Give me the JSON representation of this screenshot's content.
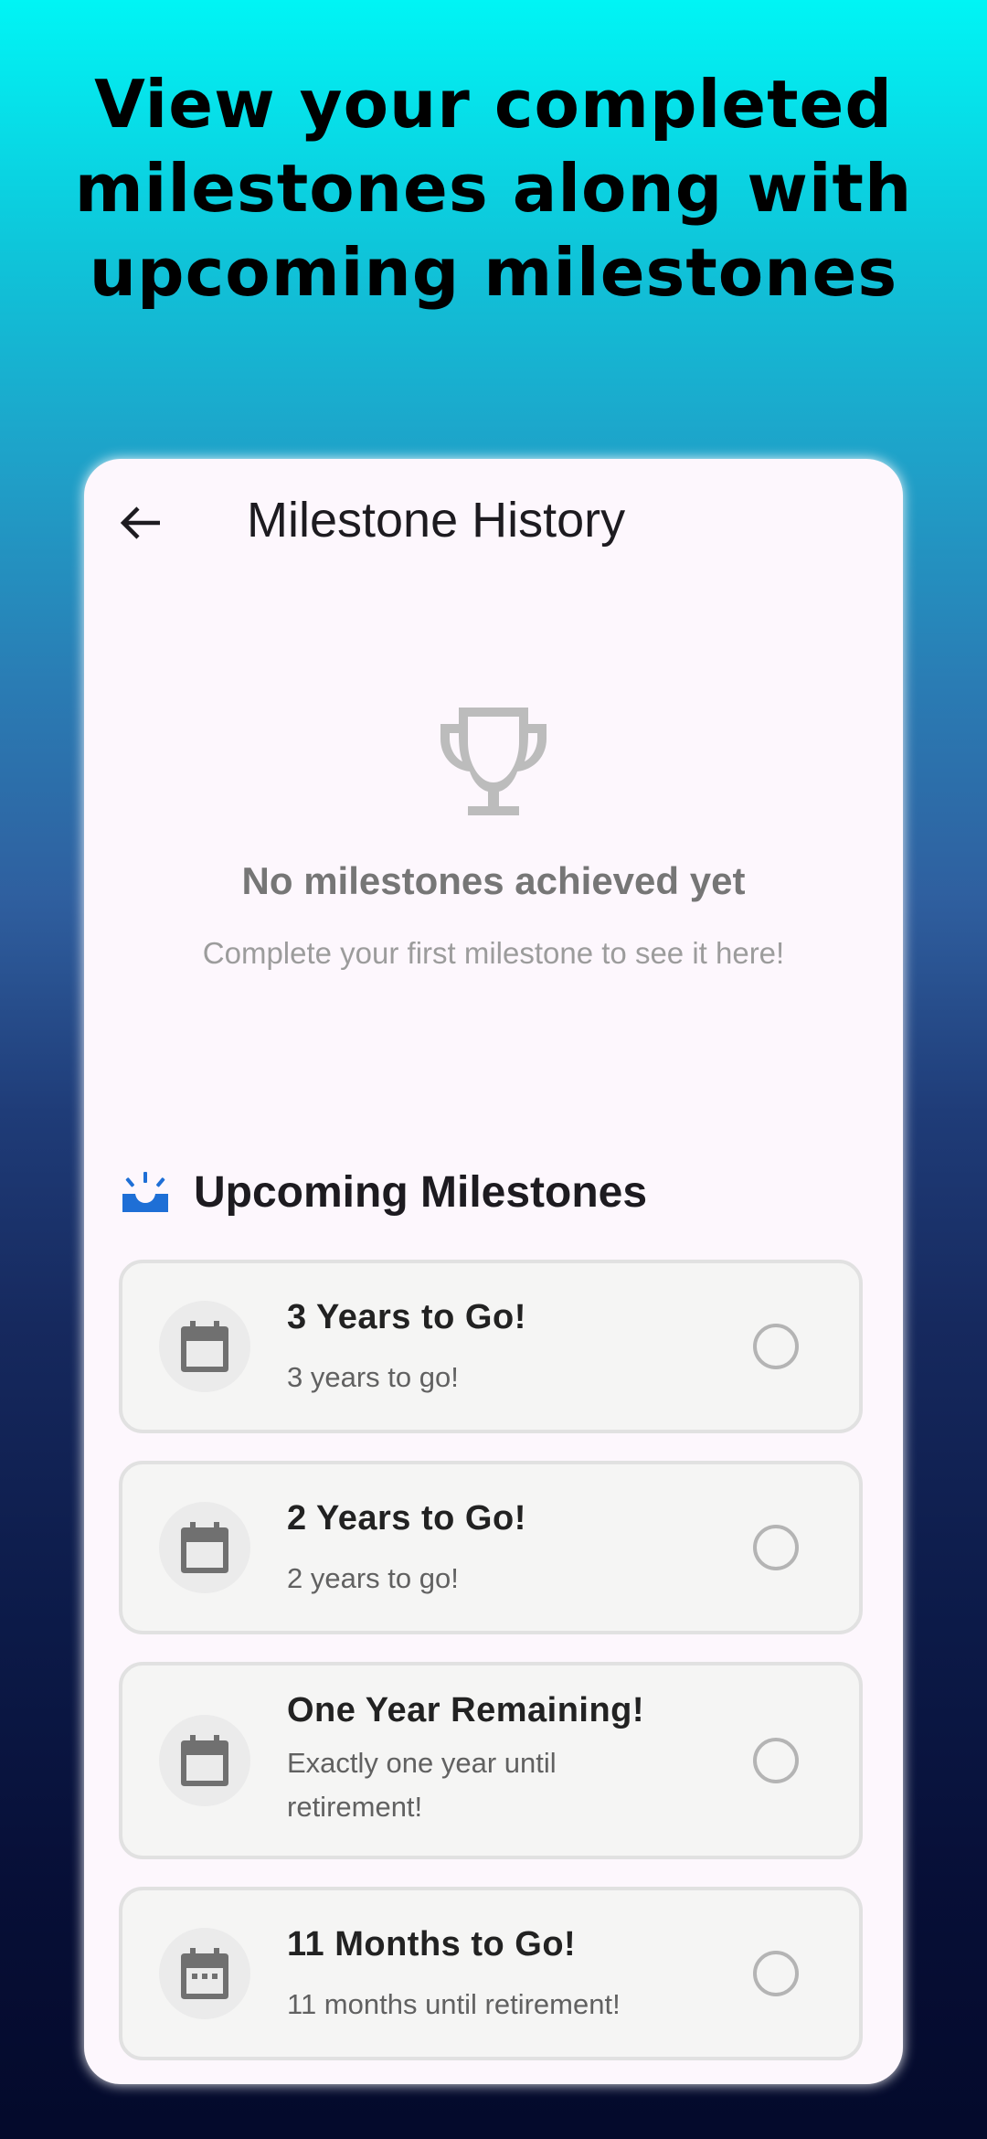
{
  "promo": {
    "headline": "View your completed milestones along with upcoming milestones"
  },
  "app_bar": {
    "back_icon": "arrow-back-icon",
    "title": "Milestone History"
  },
  "empty_state": {
    "icon": "trophy-icon",
    "title": "No milestones achieved yet",
    "subtitle": "Complete your first milestone to see it here!"
  },
  "upcoming": {
    "icon": "upcoming-icon",
    "title": "Upcoming Milestones",
    "items": [
      {
        "title": "3 Years to Go!",
        "subtitle": "3 years to go!",
        "icon": "calendar-icon",
        "completed": false
      },
      {
        "title": "2 Years to Go!",
        "subtitle": "2 years to go!",
        "icon": "calendar-icon",
        "completed": false
      },
      {
        "title": "One Year Remaining!",
        "subtitle": "Exactly one year until retirement!",
        "icon": "calendar-icon",
        "completed": false
      },
      {
        "title": "11 Months to Go!",
        "subtitle": "11 months until retirement!",
        "icon": "calendar-month-icon",
        "completed": false
      }
    ]
  },
  "colors": {
    "accent_blue": "#1e6fd6",
    "card_background": "#fdf7fd",
    "muted_text": "#767676"
  }
}
